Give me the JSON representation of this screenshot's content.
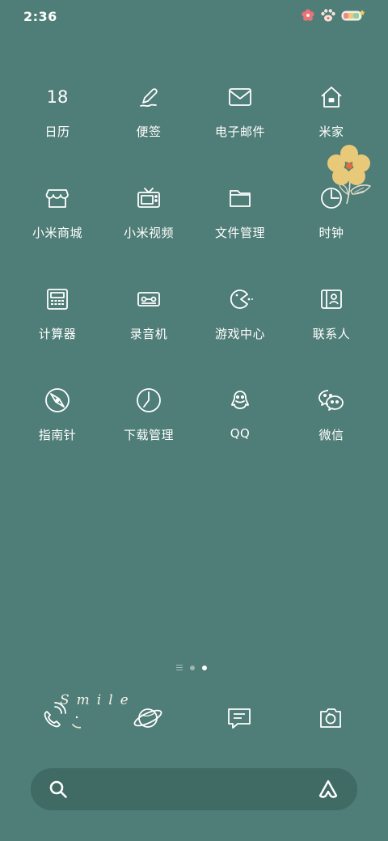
{
  "status_bar": {
    "time": "2:36",
    "icons": [
      "flower-icon",
      "paw-icon",
      "battery-icon"
    ]
  },
  "apps": [
    {
      "label": "日历",
      "icon": "calendar-icon",
      "icon_text": "18"
    },
    {
      "label": "便签",
      "icon": "notes-pen-icon"
    },
    {
      "label": "电子邮件",
      "icon": "mail-icon"
    },
    {
      "label": "米家",
      "icon": "home-icon"
    },
    {
      "label": "小米商城",
      "icon": "store-icon"
    },
    {
      "label": "小米视频",
      "icon": "tv-icon"
    },
    {
      "label": "文件管理",
      "icon": "folder-icon"
    },
    {
      "label": "时钟",
      "icon": "clock-icon"
    },
    {
      "label": "计算器",
      "icon": "calculator-icon"
    },
    {
      "label": "录音机",
      "icon": "recorder-icon"
    },
    {
      "label": "游戏中心",
      "icon": "game-icon"
    },
    {
      "label": "联系人",
      "icon": "contacts-icon"
    },
    {
      "label": "指南针",
      "icon": "compass-icon"
    },
    {
      "label": "下载管理",
      "icon": "download-icon"
    },
    {
      "label": "QQ",
      "icon": "qq-icon"
    },
    {
      "label": "微信",
      "icon": "wechat-icon"
    }
  ],
  "page_indicator": {
    "pages": 3,
    "active": 2
  },
  "dock": {
    "decoration_text": "Smile",
    "items": [
      "phone-icon",
      "browser-planet-icon",
      "messages-icon",
      "camera-icon"
    ]
  },
  "search": {
    "icon": "search-icon",
    "assistant_icon": "assistant-icon"
  },
  "colors": {
    "background": "#4f7d77",
    "search_bg": "#406a64",
    "flower": "#e8c97a",
    "flower_center": "#e0703a"
  }
}
